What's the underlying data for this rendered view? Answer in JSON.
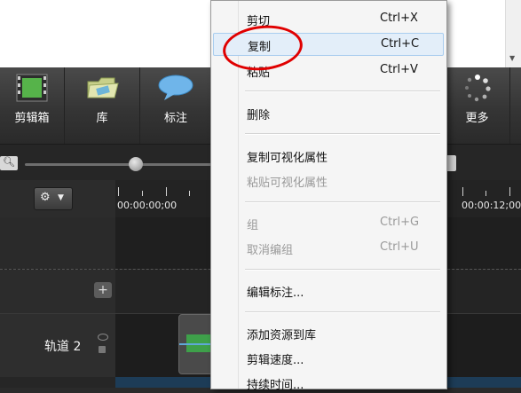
{
  "toolbar": {
    "items": [
      {
        "label": "剪辑箱",
        "icon": "film-strip-icon"
      },
      {
        "label": "库",
        "icon": "folder-icon"
      },
      {
        "label": "标注",
        "icon": "speech-bubble-icon"
      },
      {
        "label": "更多",
        "icon": "dots-spinner-icon"
      }
    ]
  },
  "timeline": {
    "start_time": "00:00:00;00",
    "end_time": "00:00:12;00",
    "track_name": "轨道 2"
  },
  "context_menu": {
    "items": [
      {
        "label": "剪切",
        "shortcut": "Ctrl+X",
        "enabled": true
      },
      {
        "label": "复制",
        "shortcut": "Ctrl+C",
        "enabled": true,
        "highlighted": true
      },
      {
        "label": "粘贴",
        "shortcut": "Ctrl+V",
        "enabled": true
      },
      {
        "label": "删除",
        "shortcut": "",
        "enabled": true
      },
      {
        "label": "复制可视化属性",
        "shortcut": "",
        "enabled": true
      },
      {
        "label": "粘贴可视化属性",
        "shortcut": "",
        "enabled": false
      },
      {
        "label": "组",
        "shortcut": "Ctrl+G",
        "enabled": false
      },
      {
        "label": "取消编组",
        "shortcut": "Ctrl+U",
        "enabled": false
      },
      {
        "label": "编辑标注...",
        "shortcut": "",
        "enabled": true
      },
      {
        "label": "添加资源到库",
        "shortcut": "",
        "enabled": true
      },
      {
        "label": "剪辑速度...",
        "shortcut": "",
        "enabled": true
      },
      {
        "label": "持续时间...",
        "shortcut": "",
        "enabled": true
      }
    ]
  },
  "colors": {
    "highlight_circle": "#e00000",
    "menu_hover": "#e3eef9"
  }
}
